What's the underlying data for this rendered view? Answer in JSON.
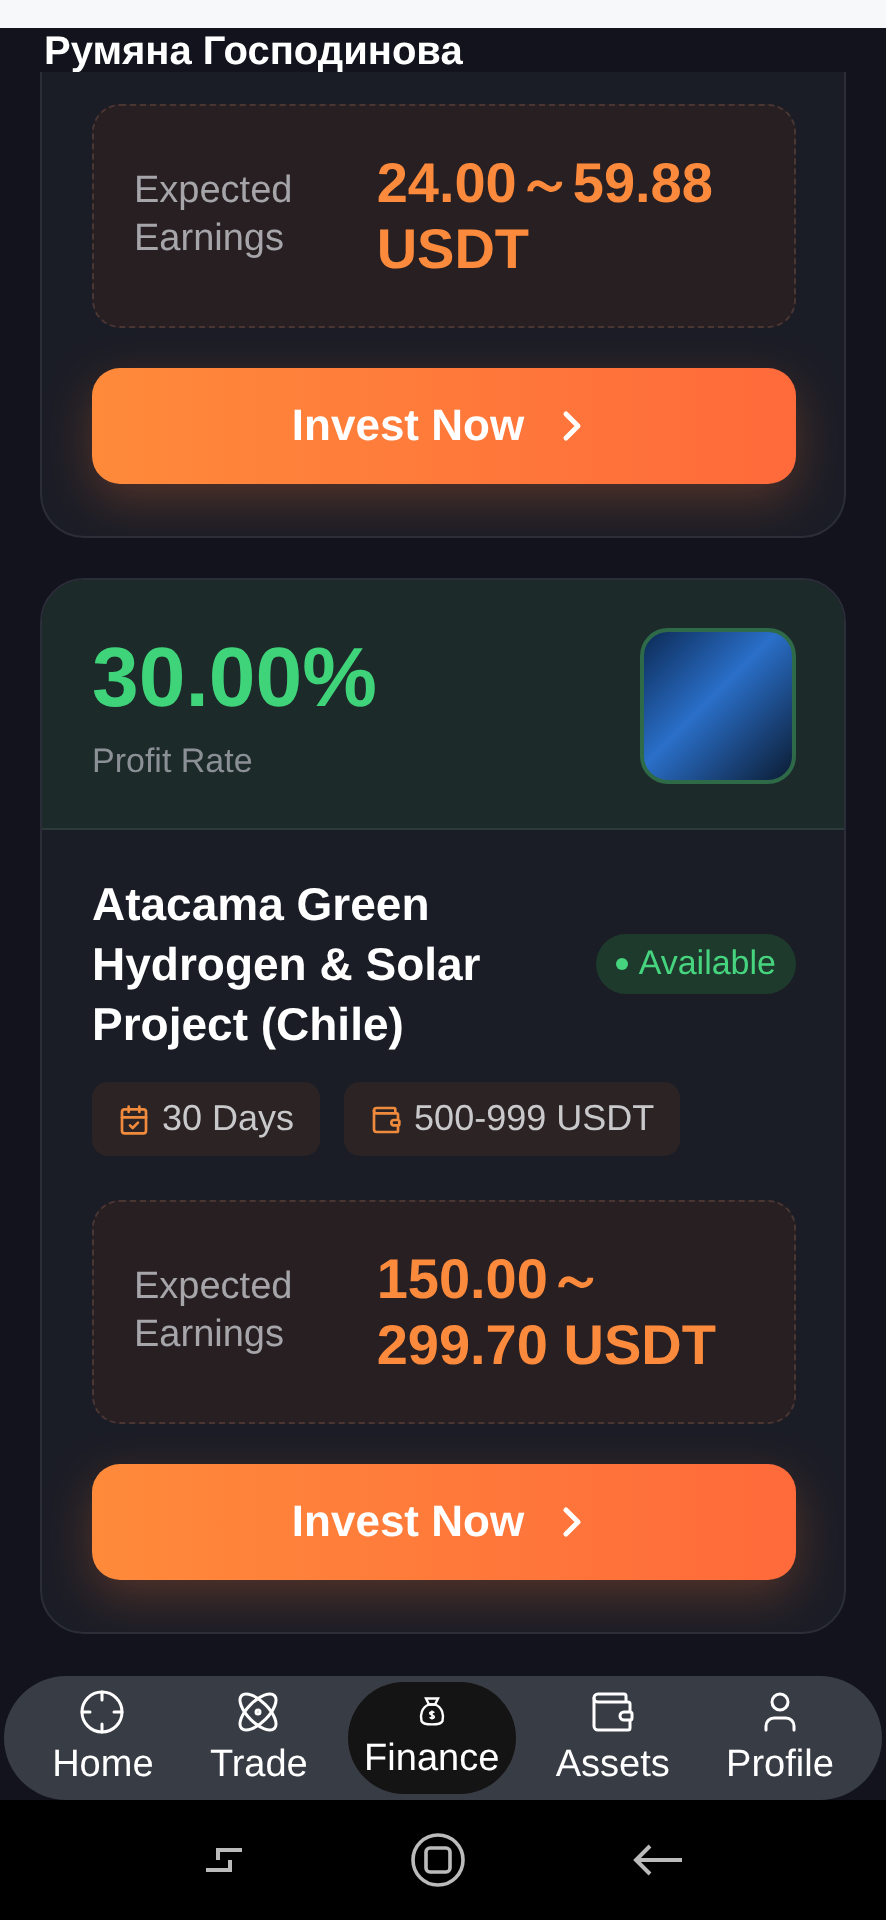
{
  "header": {
    "name": "Румяна Господинова"
  },
  "products": [
    {
      "earnings_label": "Expected Earnings",
      "earnings": "24.00～59.88 USDT",
      "button": "Invest Now"
    },
    {
      "rate": "30.00%",
      "rate_label": "Profit Rate",
      "title": "Atacama Green Hydrogen & Solar Project (Chile)",
      "status": "Available",
      "duration": "30 Days",
      "range": "500-999 USDT",
      "earnings_label": "Expected Earnings",
      "earnings": "150.00～299.70 USDT",
      "button": "Invest Now"
    }
  ],
  "nav": [
    {
      "kind": "home",
      "label": "Home",
      "selected": false
    },
    {
      "kind": "trade",
      "label": "Trade",
      "selected": false
    },
    {
      "kind": "finance",
      "label": "Finance",
      "selected": true
    },
    {
      "kind": "assets",
      "label": "Assets",
      "selected": false
    },
    {
      "kind": "profile",
      "label": "Profile",
      "selected": false
    }
  ]
}
